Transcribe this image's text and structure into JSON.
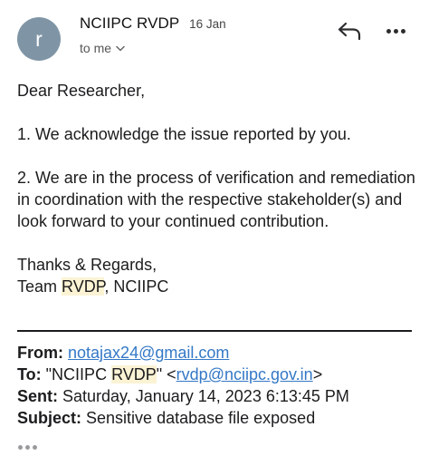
{
  "avatar_letter": "r",
  "header": {
    "sender_name": "NCIIPC  RVDP",
    "date": "16 Jan",
    "recipient": "to me"
  },
  "icons": {
    "reply": "reply-arrow-icon",
    "more": "more-horizontal-icon",
    "chevron": "chevron-down-icon",
    "quoted": "ellipsis-icon"
  },
  "body": {
    "greeting": "Dear Researcher,",
    "point1": "1. We acknowledge the issue reported by you.",
    "point2": "2. We are in the process of verification and remediation in coordination with the respective stakeholder(s) and look forward to your continued contribution.",
    "thanks": "Thanks & Regards,",
    "team_prefix": "Team ",
    "team_highlight": "RVDP",
    "team_suffix": ", NCIIPC"
  },
  "forwarded": {
    "from_label": "From:",
    "from_value": "notajax24@gmail.com",
    "to_label": "To:",
    "to_name_prefix": "\"NCIIPC ",
    "to_name_highlight": "RVDP",
    "to_name_suffix": "\" <",
    "to_email": "rvdp@nciipc.gov.in",
    "to_close": ">",
    "sent_label": "Sent:",
    "sent_value": "Saturday, January 14, 2023 6:13:45 PM",
    "subject_label": "Subject:",
    "subject_value": "Sensitive database file exposed"
  },
  "colors": {
    "avatar": "#7f95a6",
    "link": "#3478c6",
    "highlight": "#fbf3d4"
  }
}
